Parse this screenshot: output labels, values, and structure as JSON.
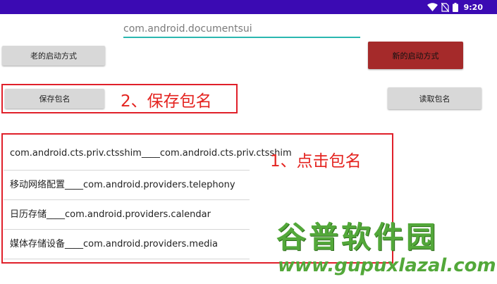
{
  "status_bar": {
    "time": "9:20",
    "background": "#3b0ab3"
  },
  "input": {
    "value": "com.android.documentsui",
    "underline_color": "#2bb7b0"
  },
  "buttons": {
    "old_launch": "老的启动方式",
    "new_launch": "新的启动方式",
    "save_package": "保存包名",
    "read_package": "读取包名"
  },
  "annotations": {
    "step2": "2、保存包名",
    "step1": "1、点击包名",
    "color": "#e0202a"
  },
  "package_list": [
    "com.android.cts.priv.ctsshim____com.android.cts.priv.ctsshim",
    "移动网络配置____com.android.providers.telephony",
    "日历存储____com.android.providers.calendar",
    "媒体存储设备____com.android.providers.media"
  ],
  "watermark": {
    "title": "谷普软件园",
    "url": "www.gupuxlazal.com"
  }
}
